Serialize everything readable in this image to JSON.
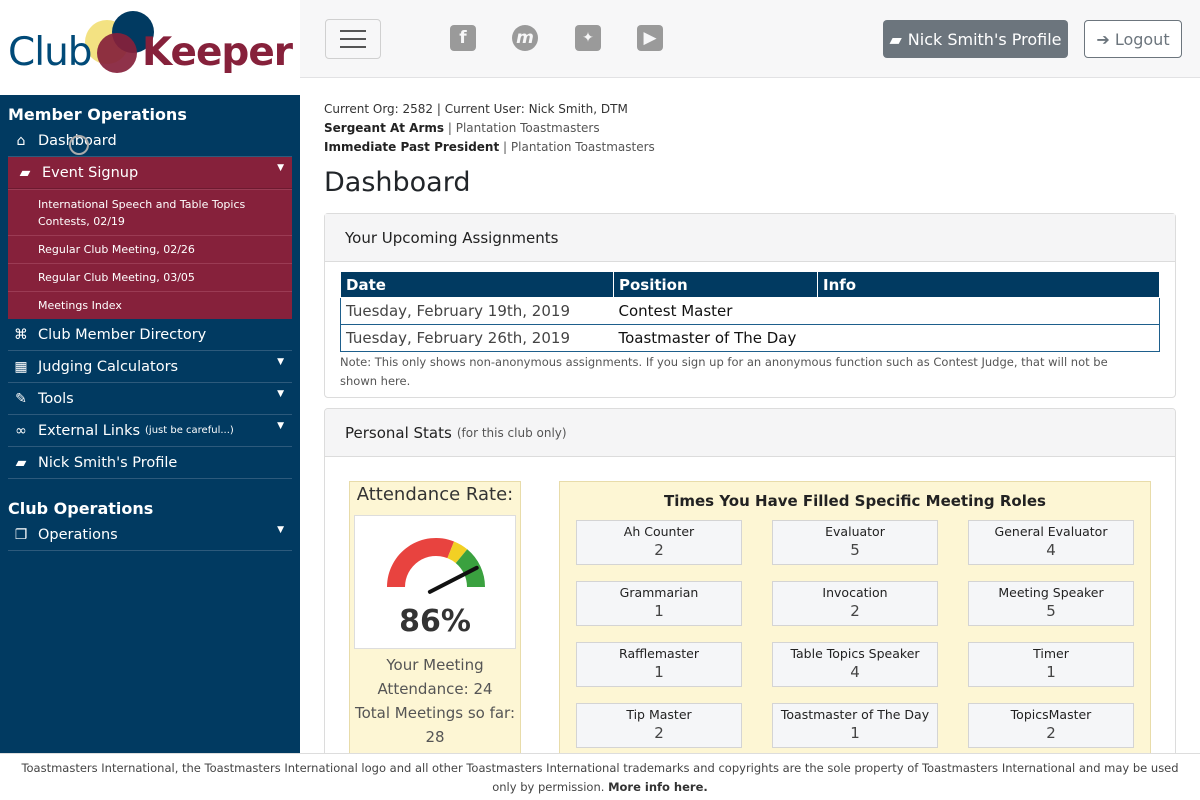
{
  "logo": {
    "part1": "Club",
    "part2": "Keeper"
  },
  "sidebar": {
    "member_ops_title": "Member Operations",
    "items": [
      {
        "label": "Dashboard",
        "icon": "home-icon"
      },
      {
        "label": "Event Signup",
        "icon": "briefcase-icon"
      },
      {
        "label": "Club Member Directory",
        "icon": "bank-icon"
      },
      {
        "label": "Judging Calculators",
        "icon": "calculator-icon"
      },
      {
        "label": "Tools",
        "icon": "wrench-icon"
      },
      {
        "label": "External Links",
        "small": "(just be careful...)",
        "icon": "link-icon"
      },
      {
        "label": "Nick Smith's Profile",
        "icon": "briefcase-icon"
      }
    ],
    "event_sub": [
      "International Speech and Table Topics Contests, 02/19",
      "Regular Club Meeting, 02/26",
      "Regular Club Meeting, 03/05",
      "Meetings Index"
    ],
    "club_ops_title": "Club Operations",
    "operations_label": "Operations"
  },
  "topbar": {
    "profile_label": "Nick Smith's Profile",
    "logout_label": "Logout"
  },
  "main": {
    "org_line": "Current Org: 2582 | Current User: Nick Smith, DTM",
    "roles": [
      {
        "role": "Sergeant At Arms",
        "club": "Plantation Toastmasters"
      },
      {
        "role": "Immediate Past President",
        "club": "Plantation Toastmasters"
      }
    ],
    "title": "Dashboard",
    "assignments": {
      "header": "Your Upcoming Assignments",
      "columns": [
        "Date",
        "Position",
        "Info"
      ],
      "rows": [
        {
          "date": "Tuesday, February 19th, 2019",
          "position": "Contest Master",
          "info": ""
        },
        {
          "date": "Tuesday, February 26th, 2019",
          "position": "Toastmaster of The Day",
          "info": ""
        }
      ],
      "note": "Note: This only shows non-anonymous assignments. If you sign up for an anonymous function such as Contest Judge, that will not be shown here."
    },
    "stats": {
      "header": "Personal Stats",
      "header_small": "(for this club only)",
      "attendance_title": "Attendance Rate:",
      "attendance_pct": "86%",
      "attendance_rate": 0.86,
      "attendance_line1": "Your Meeting",
      "attendance_line2": "Attendance: 24",
      "attendance_line3": "Total Meetings so far:",
      "attendance_line4": "28",
      "roles_title": "Times You Have Filled Specific Meeting Roles",
      "role_counts": [
        {
          "name": "Ah Counter",
          "count": "2"
        },
        {
          "name": "Evaluator",
          "count": "5"
        },
        {
          "name": "General Evaluator",
          "count": "4"
        },
        {
          "name": "Grammarian",
          "count": "1"
        },
        {
          "name": "Invocation",
          "count": "2"
        },
        {
          "name": "Meeting Speaker",
          "count": "5"
        },
        {
          "name": "Rafflemaster",
          "count": "1"
        },
        {
          "name": "Table Topics Speaker",
          "count": "4"
        },
        {
          "name": "Timer",
          "count": "1"
        },
        {
          "name": "Tip Master",
          "count": "2"
        },
        {
          "name": "Toastmaster of The Day",
          "count": "1"
        },
        {
          "name": "TopicsMaster",
          "count": "2"
        }
      ]
    }
  },
  "footer": {
    "text": "Toastmasters International, the Toastmasters International logo and all other Toastmasters International trademarks and copyrights are the sole property of Toastmasters International and may be used only by permission.",
    "link": "More info here."
  },
  "colors": {
    "sidebar_bg": "#013a61",
    "active_bg": "#86213b",
    "stats_bg": "#fdf6d4"
  }
}
